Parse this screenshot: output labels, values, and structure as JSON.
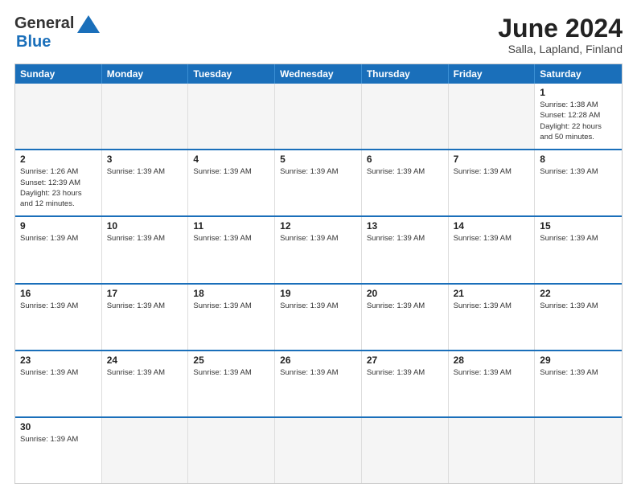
{
  "header": {
    "logo": {
      "general": "General",
      "blue": "Blue"
    },
    "title": "June 2024",
    "location": "Salla, Lapland, Finland"
  },
  "calendar": {
    "days": [
      "Sunday",
      "Monday",
      "Tuesday",
      "Wednesday",
      "Thursday",
      "Friday",
      "Saturday"
    ],
    "rows": [
      [
        {
          "day": "",
          "text": "",
          "empty": true
        },
        {
          "day": "",
          "text": "",
          "empty": true
        },
        {
          "day": "",
          "text": "",
          "empty": true
        },
        {
          "day": "",
          "text": "",
          "empty": true
        },
        {
          "day": "",
          "text": "",
          "empty": true
        },
        {
          "day": "",
          "text": "",
          "empty": true
        },
        {
          "day": "1",
          "text": "Sunrise: 1:38 AM\nSunset: 12:28 AM\nDaylight: 22 hours\nand 50 minutes."
        }
      ],
      [
        {
          "day": "2",
          "text": "Sunrise: 1:26 AM\nSunset: 12:39 AM\nDaylight: 23 hours\nand 12 minutes."
        },
        {
          "day": "3",
          "text": "Sunrise: 1:39 AM"
        },
        {
          "day": "4",
          "text": "Sunrise: 1:39 AM"
        },
        {
          "day": "5",
          "text": "Sunrise: 1:39 AM"
        },
        {
          "day": "6",
          "text": "Sunrise: 1:39 AM"
        },
        {
          "day": "7",
          "text": "Sunrise: 1:39 AM"
        },
        {
          "day": "8",
          "text": "Sunrise: 1:39 AM"
        }
      ],
      [
        {
          "day": "9",
          "text": "Sunrise: 1:39 AM"
        },
        {
          "day": "10",
          "text": "Sunrise: 1:39 AM"
        },
        {
          "day": "11",
          "text": "Sunrise: 1:39 AM"
        },
        {
          "day": "12",
          "text": "Sunrise: 1:39 AM"
        },
        {
          "day": "13",
          "text": "Sunrise: 1:39 AM"
        },
        {
          "day": "14",
          "text": "Sunrise: 1:39 AM"
        },
        {
          "day": "15",
          "text": "Sunrise: 1:39 AM"
        }
      ],
      [
        {
          "day": "16",
          "text": "Sunrise: 1:39 AM"
        },
        {
          "day": "17",
          "text": "Sunrise: 1:39 AM"
        },
        {
          "day": "18",
          "text": "Sunrise: 1:39 AM"
        },
        {
          "day": "19",
          "text": "Sunrise: 1:39 AM"
        },
        {
          "day": "20",
          "text": "Sunrise: 1:39 AM"
        },
        {
          "day": "21",
          "text": "Sunrise: 1:39 AM"
        },
        {
          "day": "22",
          "text": "Sunrise: 1:39 AM"
        }
      ],
      [
        {
          "day": "23",
          "text": "Sunrise: 1:39 AM"
        },
        {
          "day": "24",
          "text": "Sunrise: 1:39 AM"
        },
        {
          "day": "25",
          "text": "Sunrise: 1:39 AM"
        },
        {
          "day": "26",
          "text": "Sunrise: 1:39 AM"
        },
        {
          "day": "27",
          "text": "Sunrise: 1:39 AM"
        },
        {
          "day": "28",
          "text": "Sunrise: 1:39 AM"
        },
        {
          "day": "29",
          "text": "Sunrise: 1:39 AM"
        }
      ],
      [
        {
          "day": "30",
          "text": "Sunrise: 1:39 AM"
        },
        {
          "day": "",
          "text": "",
          "empty": true
        },
        {
          "day": "",
          "text": "",
          "empty": true
        },
        {
          "day": "",
          "text": "",
          "empty": true
        },
        {
          "day": "",
          "text": "",
          "empty": true
        },
        {
          "day": "",
          "text": "",
          "empty": true
        },
        {
          "day": "",
          "text": "",
          "empty": true
        }
      ]
    ]
  }
}
